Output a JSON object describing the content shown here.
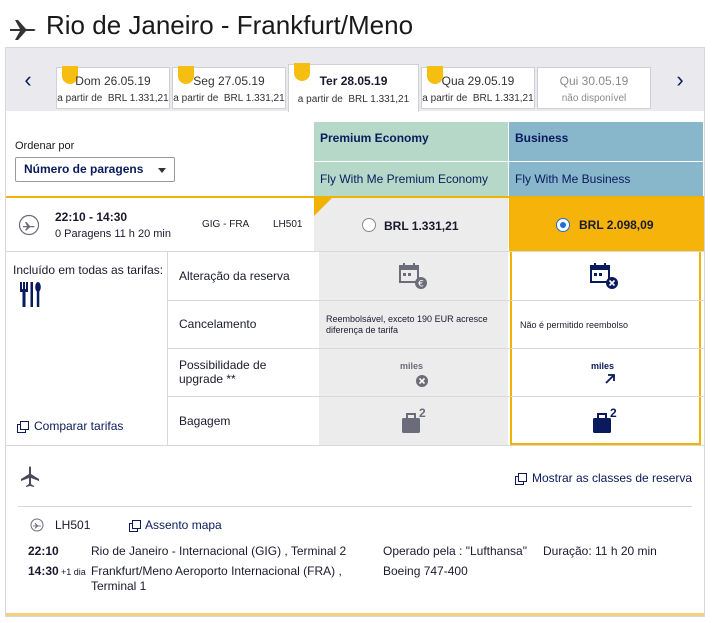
{
  "header": {
    "route_title": "Rio de Janeiro - Frankfurt/Meno"
  },
  "date_strip": {
    "prev_label": "‹",
    "next_label": "›",
    "tabs": [
      {
        "day": "Dom 26.05.19",
        "prefix": "a partir de",
        "price": "BRL 1.331,21",
        "selected": false,
        "available": true
      },
      {
        "day": "Seg 27.05.19",
        "prefix": "a partir de",
        "price": "BRL 1.331,21",
        "selected": false,
        "available": true
      },
      {
        "day": "Ter 28.05.19",
        "prefix": "a partir de",
        "price": "BRL 1.331,21",
        "selected": true,
        "available": true
      },
      {
        "day": "Qua 29.05.19",
        "prefix": "a partir de",
        "price": "BRL 1.331,21",
        "selected": false,
        "available": true
      },
      {
        "day": "Qui 30.05.19",
        "prefix": "",
        "price": "não disponível",
        "selected": false,
        "available": false
      }
    ]
  },
  "sort": {
    "label": "Ordenar por",
    "selected": "Número de paragens"
  },
  "columns": {
    "premium_economy": {
      "title": "Premium Economy",
      "subtitle": "Fly With Me Premium Economy"
    },
    "business": {
      "title": "Business",
      "subtitle": "Fly With Me Business"
    }
  },
  "flight": {
    "time": "22:10 - 14:30",
    "stops_duration": "0 Paragens 11 h 20 min",
    "route": "GIG - FRA",
    "number": "LH501",
    "pe_price": "BRL 1.331,21",
    "bu_price": "BRL 2.098,09",
    "selected_fare": "business"
  },
  "fares": {
    "included_label": "Incluído em todas as tarifas:",
    "compare_label": "Comparar tarifas",
    "rows": {
      "change": "Alteração da reserva",
      "cancel": "Cancelamento",
      "upgrade": "Possibilidade de upgrade **",
      "baggage": "Bagagem"
    },
    "pe_cancel": "Reembolsável, exceto 190 EUR acresce diferença de tarifa",
    "bu_cancel": "Não é permitido reembolso",
    "miles_label": "miles",
    "bag_count": "2"
  },
  "details": {
    "show_classes": "Mostrar as classes de reserva",
    "flight_number": "LH501",
    "seat_map": "Assento mapa",
    "dep_time": "22:10",
    "dep_place": "Rio de Janeiro - Internacional (GIG) , Terminal 2",
    "arr_time": "14:30",
    "arr_plus": "+1 dia",
    "arr_place_line1": "Frankfurt/Meno Aeroporto Internacional (FRA) ,",
    "arr_place_line2": "Terminal 1",
    "operated_by": "Operado pela : \"Lufthansa\"",
    "duration": "Duração: 11 h 20 min",
    "aircraft": "Boeing 747-400"
  },
  "colors": {
    "accent_gold": "#f2b200",
    "premium_economy": "#b6d8c8",
    "business": "#88b6cb",
    "navy": "#0a1a5c"
  },
  "icons": [
    "airplane-icon",
    "departure-icon",
    "cutlery-icon",
    "calendar-change-icon",
    "miles-icon",
    "baggage-icon",
    "external-link-icon"
  ]
}
